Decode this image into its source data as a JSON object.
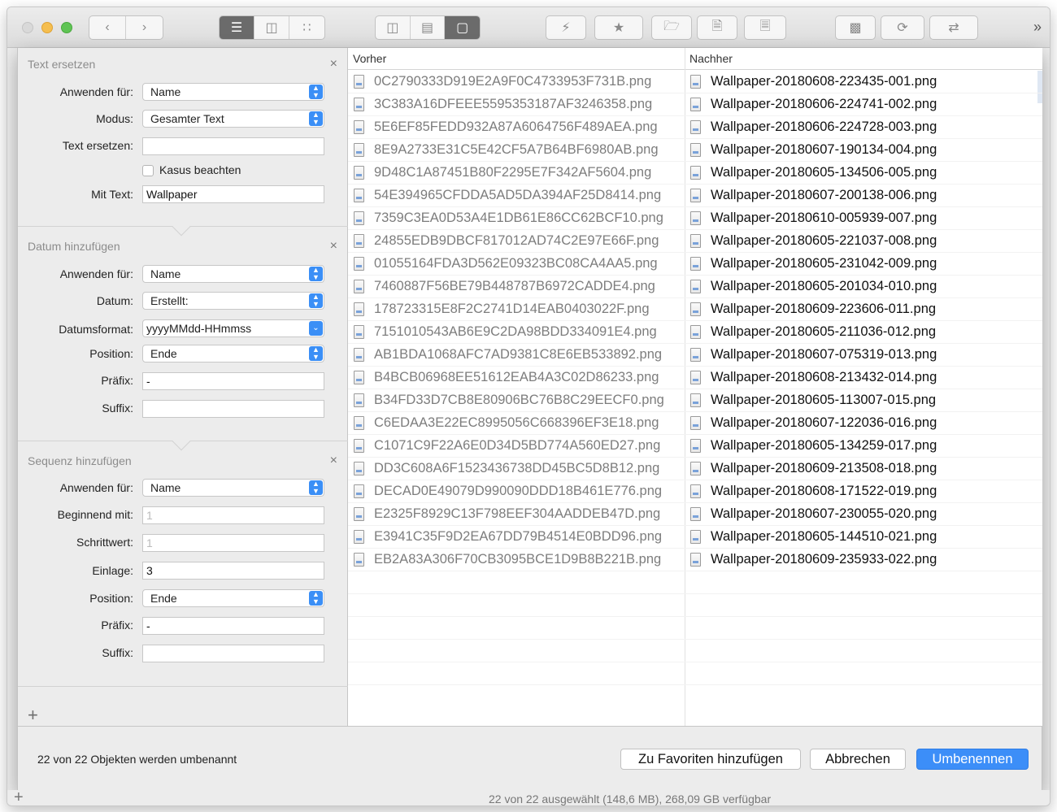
{
  "toolbar": {
    "view_buttons": [
      "list-view-icon",
      "column-view-icon",
      "grid-view-icon"
    ],
    "layout_buttons": [
      "split-vertical-icon",
      "split-horizontal-icon",
      "single-pane-icon"
    ],
    "action_buttons": [
      "lightning-icon",
      "star-icon",
      "new-folder-icon",
      "new-file-icon",
      "blank-file-icon",
      "terminal-icon",
      "sync-icon",
      "compare-icon"
    ],
    "more": "»"
  },
  "sections": {
    "replace": {
      "title": "Text ersetzen",
      "close": "×",
      "apply_label": "Anwenden für:",
      "apply_value": "Name",
      "mode_label": "Modus:",
      "mode_value": "Gesamter Text",
      "replace_label": "Text ersetzen:",
      "replace_value": "",
      "case_label": "Kasus beachten",
      "with_label": "Mit Text:",
      "with_value": "Wallpaper"
    },
    "date": {
      "title": "Datum hinzufügen",
      "close": "×",
      "apply_label": "Anwenden für:",
      "apply_value": "Name",
      "date_label": "Datum:",
      "date_value": "Erstellt:",
      "format_label": "Datumsformat:",
      "format_value": "yyyyMMdd-HHmmss",
      "position_label": "Position:",
      "position_value": "Ende",
      "prefix_label": "Präfix:",
      "prefix_value": "-",
      "suffix_label": "Suffix:",
      "suffix_value": ""
    },
    "sequence": {
      "title": "Sequenz hinzufügen",
      "close": "×",
      "apply_label": "Anwenden für:",
      "apply_value": "Name",
      "start_label": "Beginnend mit:",
      "start_placeholder": "1",
      "step_label": "Schrittwert:",
      "step_placeholder": "1",
      "padding_label": "Einlage:",
      "padding_value": "3",
      "position_label": "Position:",
      "position_value": "Ende",
      "prefix_label": "Präfix:",
      "prefix_value": "-",
      "suffix_label": "Suffix:",
      "suffix_value": ""
    }
  },
  "add_symbol": "+",
  "table": {
    "col_before": "Vorher",
    "col_after": "Nachher",
    "rows": [
      {
        "before": "0C2790333D919E2A9F0C4733953F731B.png",
        "after": "Wallpaper-20180608-223435-001.png"
      },
      {
        "before": "3C383A16DFEEE5595353187AF3246358.png",
        "after": "Wallpaper-20180606-224741-002.png"
      },
      {
        "before": "5E6EF85FEDD932A87A6064756F489AEA.png",
        "after": "Wallpaper-20180606-224728-003.png"
      },
      {
        "before": "8E9A2733E31C5E42CF5A7B64BF6980AB.png",
        "after": "Wallpaper-20180607-190134-004.png"
      },
      {
        "before": "9D48C1A87451B80F2295E7F342AF5604.png",
        "after": "Wallpaper-20180605-134506-005.png"
      },
      {
        "before": "54E394965CFDDA5AD5DA394AF25D8414.png",
        "after": "Wallpaper-20180607-200138-006.png"
      },
      {
        "before": "7359C3EA0D53A4E1DB61E86CC62BCF10.png",
        "after": "Wallpaper-20180610-005939-007.png"
      },
      {
        "before": "24855EDB9DBCF817012AD74C2E97E66F.png",
        "after": "Wallpaper-20180605-221037-008.png"
      },
      {
        "before": "01055164FDA3D562E09323BC08CA4AA5.png",
        "after": "Wallpaper-20180605-231042-009.png"
      },
      {
        "before": "7460887F56BE79B448787B6972CADDE4.png",
        "after": "Wallpaper-20180605-201034-010.png"
      },
      {
        "before": "178723315E8F2C2741D14EAB0403022F.png",
        "after": "Wallpaper-20180609-223606-011.png"
      },
      {
        "before": "7151010543AB6E9C2DA98BDD334091E4.png",
        "after": "Wallpaper-20180605-211036-012.png"
      },
      {
        "before": "AB1BDA1068AFC7AD9381C8E6EB533892.png",
        "after": "Wallpaper-20180607-075319-013.png"
      },
      {
        "before": "B4BCB06968EE51612EAB4A3C02D86233.png",
        "after": "Wallpaper-20180608-213432-014.png"
      },
      {
        "before": "B34FD33D7CB8E80906BC76B8C29EECF0.png",
        "after": "Wallpaper-20180605-113007-015.png"
      },
      {
        "before": "C6EDAA3E22EC8995056C668396EF3E18.png",
        "after": "Wallpaper-20180607-122036-016.png"
      },
      {
        "before": "C1071C9F22A6E0D34D5BD774A560ED27.png",
        "after": "Wallpaper-20180605-134259-017.png"
      },
      {
        "before": "DD3C608A6F1523436738DD45BC5D8B12.png",
        "after": "Wallpaper-20180609-213508-018.png"
      },
      {
        "before": "DECAD0E49079D990090DDD18B461E776.png",
        "after": "Wallpaper-20180608-171522-019.png"
      },
      {
        "before": "E2325F8929C13F798EEF304AADDEB47D.png",
        "after": "Wallpaper-20180607-230055-020.png"
      },
      {
        "before": "E3941C35F9D2EA67DD79B4514E0BDD96.png",
        "after": "Wallpaper-20180605-144510-021.png"
      },
      {
        "before": "EB2A83A306F70CB3095BCE1D9B8B221B.png",
        "after": "Wallpaper-20180609-235933-022.png"
      }
    ]
  },
  "footer": {
    "status": "22 von 22 Objekten werden umbenannt",
    "favorites_label": "Zu Favoriten hinzufügen",
    "cancel_label": "Abbrechen",
    "rename_label": "Umbenennen"
  },
  "bottom_bar": {
    "plus": "+",
    "text": "22 von 22 ausgewählt (148,6 MB), 268,09 GB verfügbar"
  },
  "colors": {
    "accent": "#3c8ef8",
    "traffic_min": "#f5be4f",
    "traffic_max": "#5fc454"
  }
}
